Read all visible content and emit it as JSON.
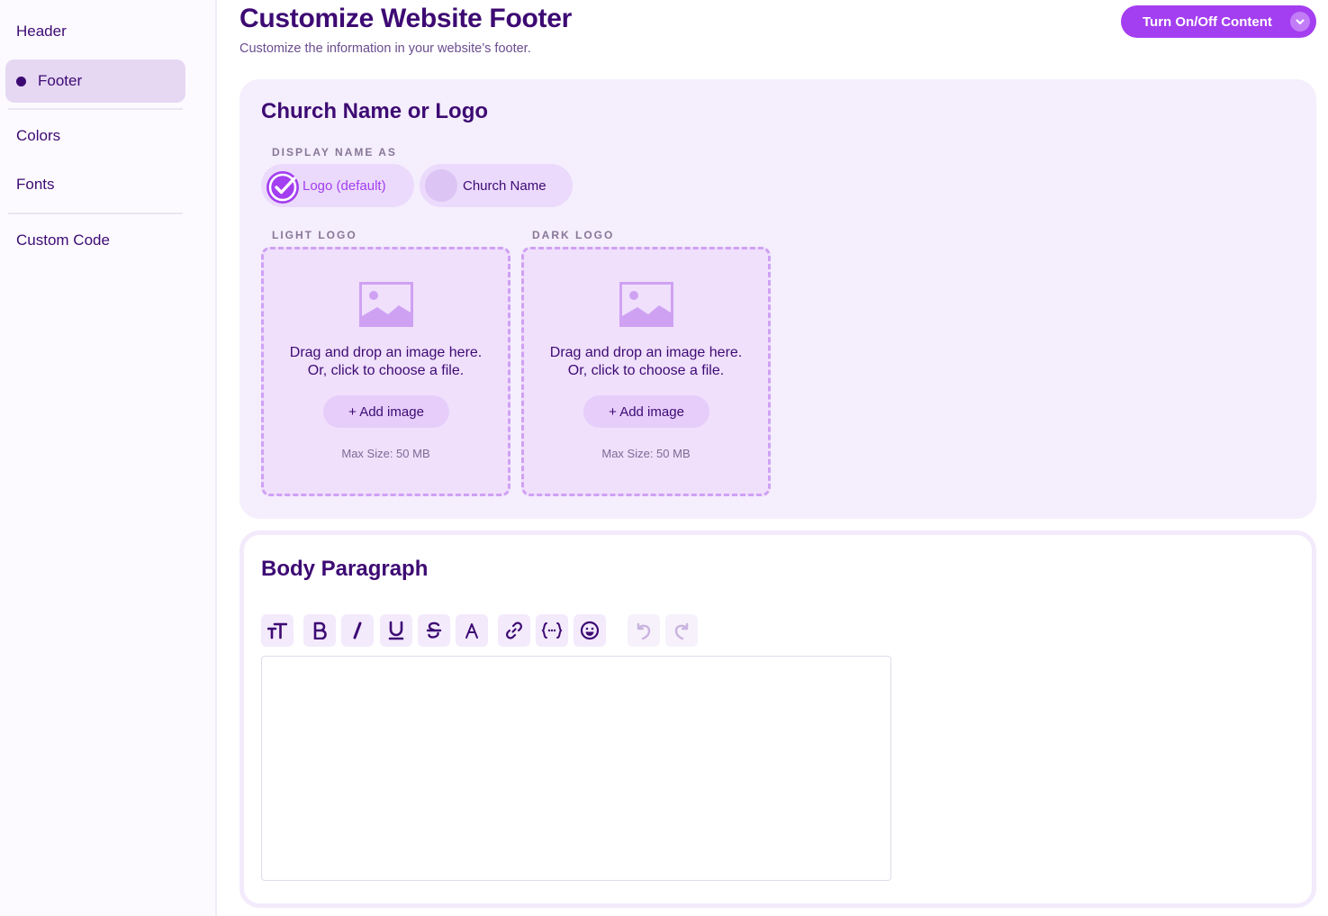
{
  "sidebar": {
    "items": [
      {
        "label": "Header"
      },
      {
        "label": "Footer"
      },
      {
        "label": "Colors"
      },
      {
        "label": "Fonts"
      },
      {
        "label": "Custom Code"
      }
    ],
    "active": "Footer"
  },
  "header": {
    "title": "Customize Website Footer",
    "subtitle": "Customize the information in your website’s footer.",
    "toggle_label": "Turn On/Off Content"
  },
  "name_logo": {
    "title": "Church Name or Logo",
    "display_label": "DISPLAY NAME AS",
    "options": [
      {
        "label": "Logo (default)",
        "selected": true
      },
      {
        "label": "Church Name",
        "selected": false
      }
    ],
    "uploads": [
      {
        "label": "LIGHT LOGO",
        "line1": "Drag and drop an image here.",
        "line2": "Or, click to choose a file.",
        "button": "+ Add image",
        "max_size": "Max Size: 50 MB"
      },
      {
        "label": "DARK LOGO",
        "line1": "Drag and drop an image here.",
        "line2": "Or, click to choose a file.",
        "button": "+ Add image",
        "max_size": "Max Size: 50 MB"
      }
    ]
  },
  "body_paragraph": {
    "title": "Body Paragraph",
    "editor_value": "",
    "toolbar": [
      "text-size-icon",
      "bold-icon",
      "italic-icon",
      "underline-icon",
      "strikethrough-icon",
      "font-color-icon",
      "link-icon",
      "variable-icon",
      "emoji-icon",
      "undo-icon",
      "redo-icon"
    ]
  },
  "colors": {
    "primary": "#3d0a73",
    "accent": "#a43ef1",
    "card_bg": "#f5eefd"
  }
}
